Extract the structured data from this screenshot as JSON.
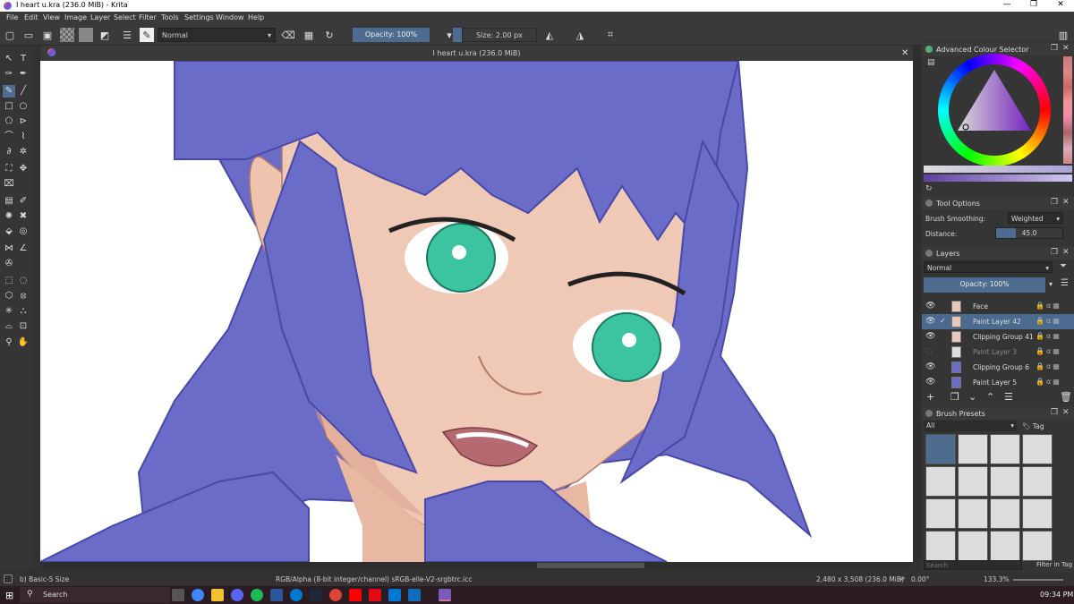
{
  "window": {
    "title": "I heart u.kra (236.0 MiB) - Krita"
  },
  "menu": [
    "File",
    "Edit",
    "View",
    "Image",
    "Layer",
    "Select",
    "Filter",
    "Tools",
    "Settings",
    "Window",
    "Help"
  ],
  "toolbar": {
    "blend_mode": "Normal",
    "opacity": "Opacity: 100%",
    "size": "Size: 2.00 px"
  },
  "document": {
    "tab_title": "I heart u.kra (236.0 MiB)"
  },
  "colors": {
    "hair": "#6b6bc8",
    "hair_outline": "#4848a8",
    "skin": "#f0c9b6",
    "skin_shadow": "#d89a86",
    "eye": "#3cc4a0",
    "lips": "#b56a72",
    "accent": "#4d6c8f"
  },
  "dock": {
    "color_selector": {
      "title": "Advanced Colour Selector"
    },
    "tool_options": {
      "title": "Tool Options",
      "smoothing_label": "Brush Smoothing:",
      "smoothing_value": "Weighted",
      "distance_label": "Distance:",
      "distance_value": "45.0"
    },
    "layers": {
      "title": "Layers",
      "blend": "Normal",
      "opacity": "Opacity:  100%",
      "items": [
        {
          "name": "Face",
          "selected": false
        },
        {
          "name": "Paint Layer 42",
          "selected": true
        },
        {
          "name": "Clipping Group 41",
          "selected": false
        },
        {
          "name": "Paint Layer 3",
          "selected": false
        },
        {
          "name": "Clipping Group 6",
          "selected": false
        },
        {
          "name": "Paint Layer 5",
          "selected": false
        }
      ]
    },
    "brush_presets": {
      "title": "Brush Presets",
      "filter": "All",
      "tag": "Tag",
      "search_placeholder": "Search",
      "filter_in_tag": "Filter in Tag"
    }
  },
  "status": {
    "brush": "b) Basic-5 Size",
    "color_space": "RGB/Alpha (8-bit integer/channel)  sRGB-elle-V2-srgbtrc.icc",
    "dimensions": "2,480 x 3,508 (236.0 MiB)",
    "rotation": "0.00°",
    "zoom": "133.3%"
  },
  "taskbar": {
    "search": "Search",
    "time": "09:34 PM"
  }
}
